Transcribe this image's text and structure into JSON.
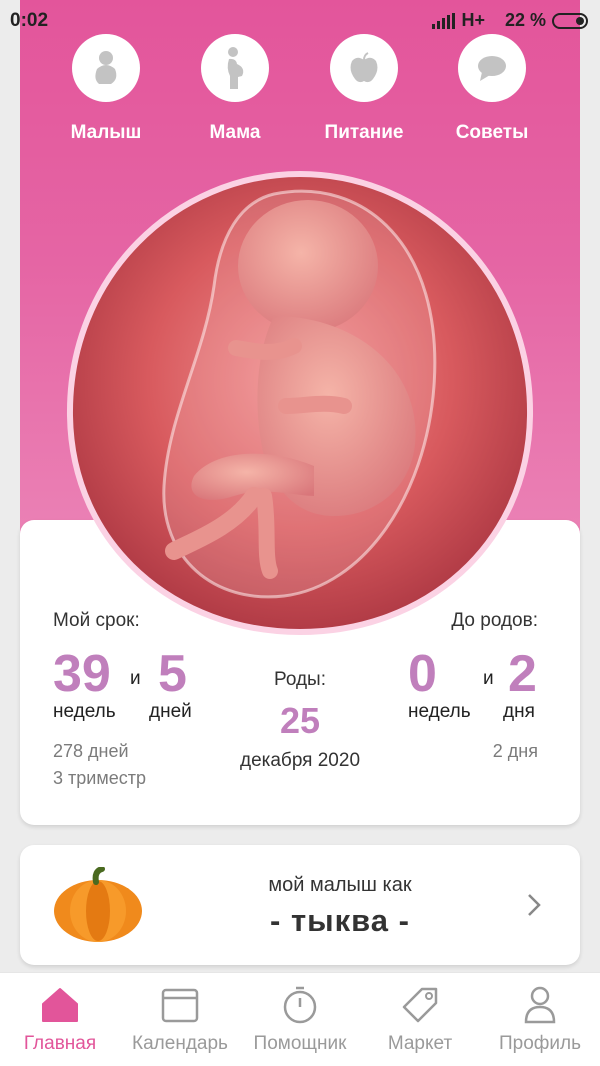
{
  "status_bar": {
    "time": "0:02",
    "network": "H+",
    "battery": "22 %"
  },
  "top_nav": [
    {
      "label": "Малыш",
      "icon": "baby-icon"
    },
    {
      "label": "Мама",
      "icon": "pregnant-woman-icon"
    },
    {
      "label": "Питание",
      "icon": "apple-icon"
    },
    {
      "label": "Советы",
      "icon": "chat-bubble-icon"
    }
  ],
  "term": {
    "label": "Мой срок:",
    "weeks_value": "39",
    "conj": "и",
    "days_value": "5",
    "weeks_unit": "недель",
    "days_unit": "дней",
    "total_days": "278 дней",
    "trimester": "3 триместр"
  },
  "birth": {
    "label": "Роды:",
    "day": "25",
    "month_year": "декабря 2020"
  },
  "until_birth": {
    "label": "До родов:",
    "weeks_value": "0",
    "conj": "и",
    "days_value": "2",
    "weeks_unit": "недель",
    "days_unit": "дня",
    "total_days": "2 дня"
  },
  "fruit": {
    "title": "мой малыш как",
    "name": "- тыква -",
    "icon": "pumpkin-icon"
  },
  "tab_bar": [
    {
      "label": "Главная",
      "icon": "home-icon",
      "active": true
    },
    {
      "label": "Календарь",
      "icon": "calendar-icon",
      "active": false
    },
    {
      "label": "Помощник",
      "icon": "stopwatch-icon",
      "active": false
    },
    {
      "label": "Маркет",
      "icon": "tag-icon",
      "active": false
    },
    {
      "label": "Профиль",
      "icon": "profile-icon",
      "active": false
    }
  ],
  "colors": {
    "accent": "#e3559b",
    "number": "#c07fbc"
  }
}
